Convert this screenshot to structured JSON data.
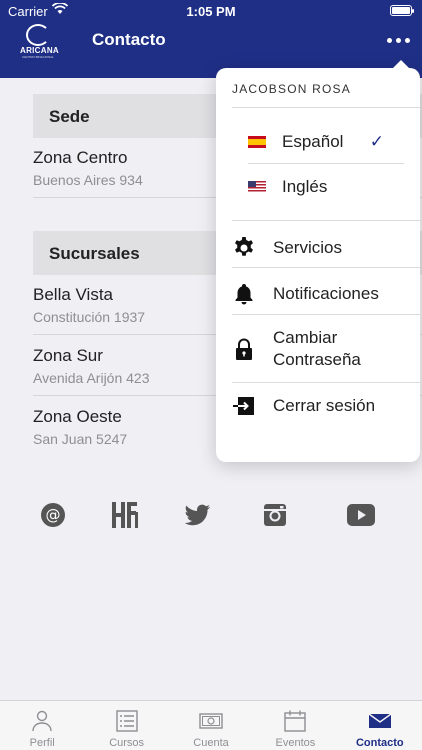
{
  "status": {
    "carrier": "Carrier",
    "time": "1:05 PM"
  },
  "header": {
    "logo_text": "ARICANA",
    "logo_sub": "CENTRO BINACIONAL",
    "title": "Contacto"
  },
  "sede": {
    "heading": "Sede",
    "items": [
      {
        "name": "Zona Centro",
        "address": "Buenos Aires 934"
      }
    ]
  },
  "sucursales": {
    "heading": "Sucursales",
    "items": [
      {
        "name": "Bella Vista",
        "address": "Constitución 1937"
      },
      {
        "name": "Zona Sur",
        "address": "Avenida Arijón 423"
      },
      {
        "name": "Zona Oeste",
        "address": "San Juan 5247"
      }
    ]
  },
  "socials": [
    "email-icon",
    "hfl-icon",
    "twitter-icon",
    "instagram-icon",
    "youtube-icon"
  ],
  "menu": {
    "user": "JACOBSON ROSA",
    "languages": [
      {
        "label": "Español",
        "flag": "spain-flag",
        "selected": true
      },
      {
        "label": "Inglés",
        "flag": "usa-flag",
        "selected": false
      }
    ],
    "check": "✓",
    "services": "Servicios",
    "notifications": "Notificaciones",
    "change_password": "Cambiar Contraseña",
    "logout": "Cerrar sesión"
  },
  "tabbar": {
    "tabs": [
      {
        "label": "Perfil",
        "icon": "person-icon"
      },
      {
        "label": "Cursos",
        "icon": "list-icon"
      },
      {
        "label": "Cuenta",
        "icon": "money-icon"
      },
      {
        "label": "Eventos",
        "icon": "calendar-icon"
      },
      {
        "label": "Contacto",
        "icon": "envelope-icon",
        "active": true
      }
    ]
  },
  "colors": {
    "primary": "#1f2f86",
    "background": "#efeff4"
  }
}
